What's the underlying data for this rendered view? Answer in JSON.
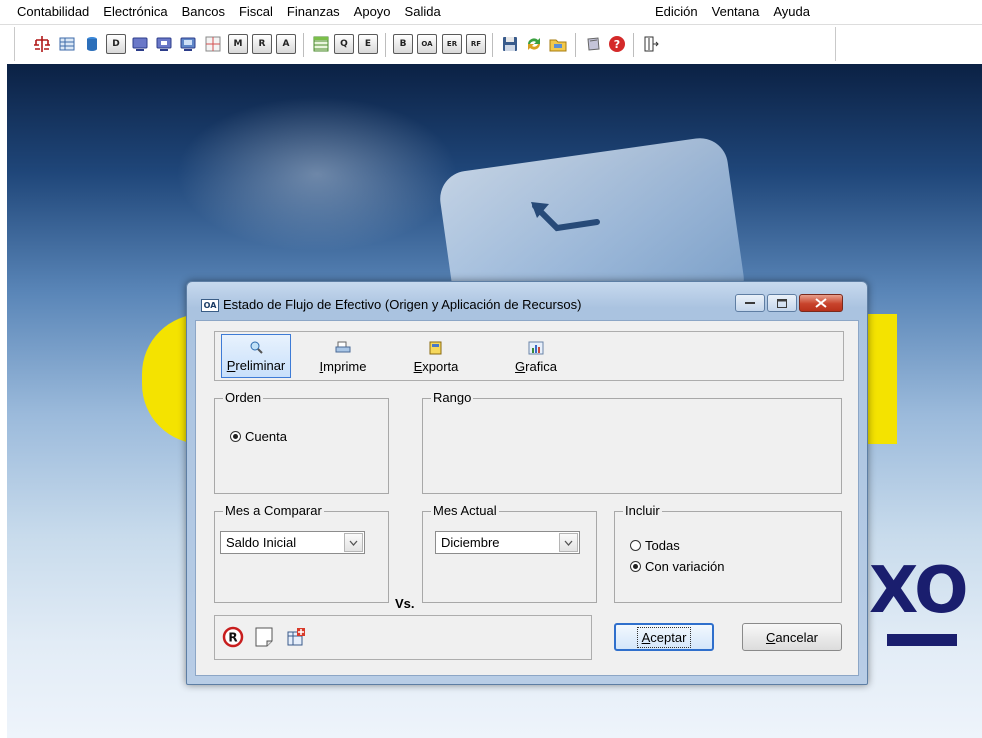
{
  "menubar": {
    "left_items": [
      "Contabilidad",
      "Electrónica",
      "Bancos",
      "Fiscal",
      "Finanzas",
      "Apoyo",
      "Salida"
    ],
    "right_items": [
      "Edición",
      "Ventana",
      "Ayuda"
    ]
  },
  "toolbar": {
    "letters": {
      "d": "D",
      "m": "M",
      "r": "R",
      "a": "A",
      "q": "Q",
      "e": "E",
      "b": "B",
      "oa": "OA",
      "er": "ER",
      "rf": "RF"
    }
  },
  "dialog": {
    "title_icon": "OA",
    "title": "Estado de Flujo de Efectivo (Origen y Aplicación de Recursos)",
    "actions": {
      "preliminar": {
        "hotkey": "P",
        "rest": "reliminar"
      },
      "imprime": {
        "hotkey": "I",
        "rest": "mprime"
      },
      "exporta": {
        "hotkey": "E",
        "rest": "xporta"
      },
      "grafica": {
        "hotkey": "G",
        "rest": "rafica"
      }
    },
    "orden": {
      "legend": "Orden",
      "option": "Cuenta"
    },
    "rango": {
      "legend": "Rango"
    },
    "mes_comparar": {
      "legend": "Mes a Comparar",
      "value": "Saldo Inicial"
    },
    "vs": "Vs.",
    "mes_actual": {
      "legend": "Mes Actual",
      "value": "Diciembre"
    },
    "incluir": {
      "legend": "Incluir",
      "options": [
        "Todas",
        "Con variación"
      ],
      "selected": "Con variación"
    },
    "buttons": {
      "aceptar": {
        "hotkey": "A",
        "rest": "ceptar"
      },
      "cancelar": {
        "hotkey": "C",
        "rest": "ancelar"
      }
    }
  },
  "colors": {
    "accent": "#3d7bd6",
    "logo_yellow": "#f4e300",
    "logo_navy": "#1a1e6e"
  }
}
